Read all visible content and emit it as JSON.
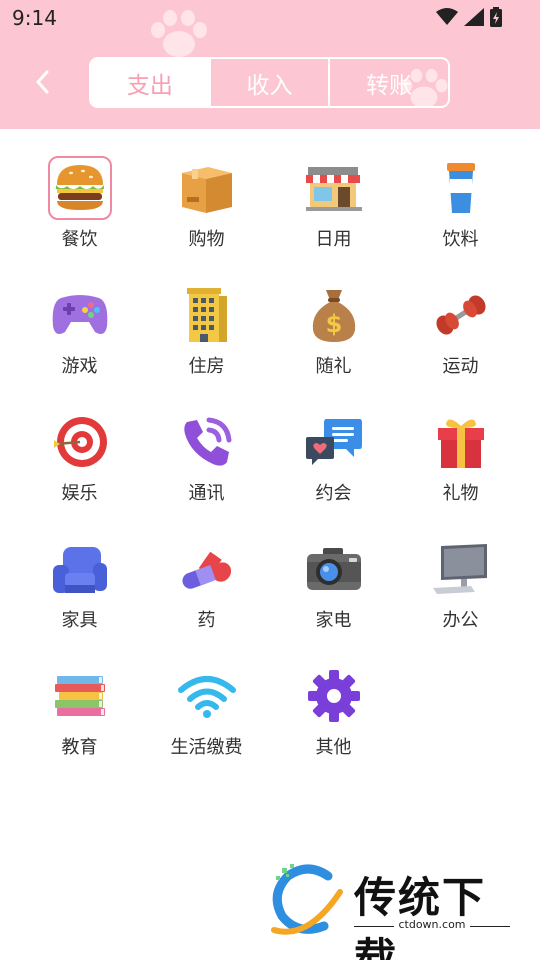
{
  "status_bar": {
    "time": "9:14"
  },
  "tabs": [
    {
      "label": "支出",
      "active": true
    },
    {
      "label": "收入",
      "active": false
    },
    {
      "label": "转账",
      "active": false
    }
  ],
  "categories": [
    {
      "label": "餐饮",
      "icon": "burger-icon",
      "selected": true
    },
    {
      "label": "购物",
      "icon": "box-icon"
    },
    {
      "label": "日用",
      "icon": "store-icon"
    },
    {
      "label": "饮料",
      "icon": "cup-icon"
    },
    {
      "label": "游戏",
      "icon": "gamepad-icon"
    },
    {
      "label": "住房",
      "icon": "building-icon"
    },
    {
      "label": "随礼",
      "icon": "money-bag-icon"
    },
    {
      "label": "运动",
      "icon": "dumbbell-icon"
    },
    {
      "label": "娱乐",
      "icon": "target-icon"
    },
    {
      "label": "通讯",
      "icon": "phone-icon"
    },
    {
      "label": "约会",
      "icon": "chat-icon"
    },
    {
      "label": "礼物",
      "icon": "gift-icon"
    },
    {
      "label": "家具",
      "icon": "armchair-icon"
    },
    {
      "label": "药",
      "icon": "pill-icon"
    },
    {
      "label": "家电",
      "icon": "camera-icon"
    },
    {
      "label": "办公",
      "icon": "monitor-icon"
    },
    {
      "label": "教育",
      "icon": "books-icon"
    },
    {
      "label": "生活缴费",
      "icon": "wifi-icon"
    },
    {
      "label": "其他",
      "icon": "gear-icon"
    }
  ],
  "watermark": {
    "title": "传统下载",
    "url": "ctdown.com"
  },
  "colors": {
    "header": "#fdc6d3",
    "accent": "#f7a0b4",
    "selected_border": "#f08aa2"
  }
}
